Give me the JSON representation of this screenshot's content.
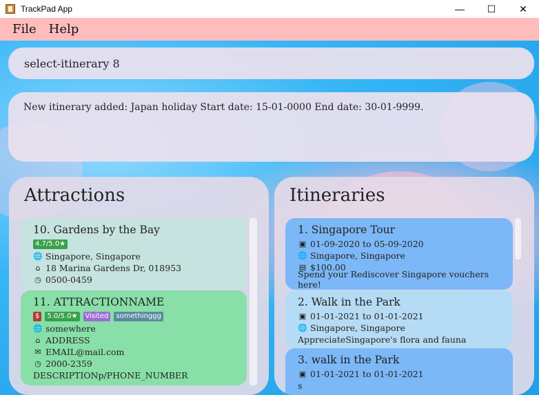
{
  "window": {
    "title": "TrackPad App",
    "minimize": "—",
    "maximize": "☐",
    "close": "✕"
  },
  "menu": {
    "file": "File",
    "help": "Help"
  },
  "command": {
    "value": "select-itinerary 8"
  },
  "result": {
    "text": "New itinerary added: Japan holiday Start date: 15-01-0000 End date: 30-01-9999."
  },
  "attractions": {
    "title": "Attractions",
    "items": [
      {
        "title": "10.  Gardens by the Bay",
        "rating": "4.7/5.0★",
        "location": "Singapore, Singapore",
        "address": "18 Marina Gardens Dr, 018953",
        "hours": "0500-0459"
      },
      {
        "title": "11.  ATTRACTIONNAME",
        "price_tag": "$",
        "rating": "5.0/5.0★",
        "visited": "Visited",
        "tag": "somethinggg",
        "location": "somewhere",
        "address": "ADDRESS",
        "email": "EMAIL@mail.com",
        "hours": "2000-2359",
        "description": "DESCRIPTIONp/PHONE_NUMBER"
      }
    ]
  },
  "itineraries": {
    "title": "Itineraries",
    "items": [
      {
        "title": "1.  Singapore Tour",
        "dates": "01-09-2020 to 05-09-2020",
        "location": "Singapore, Singapore",
        "budget": "$100.00",
        "description": "Spend your Rediscover Singapore vouchers here!"
      },
      {
        "title": "2.  Walk in the Park",
        "dates": "01-01-2021 to 01-01-2021",
        "location": "Singapore, Singapore",
        "description": "AppreciateSingapore's flora and fauna"
      },
      {
        "title": "3.  walk in the Park",
        "dates": "01-01-2021 to 01-01-2021",
        "extra": "s"
      }
    ]
  },
  "colors": {
    "menubar": "#ffbcbc",
    "attraction_card_1": "#c6e3e0",
    "attraction_card_2": "#88dfa7",
    "itinerary_selected": "#7cb8f7",
    "itinerary_card": "#b6dcf5",
    "rating_tag": "#3aa04a",
    "price_tag": "#b33a3a",
    "visited_tag": "#a06ad8",
    "custom_tag": "#5a8aa0"
  }
}
